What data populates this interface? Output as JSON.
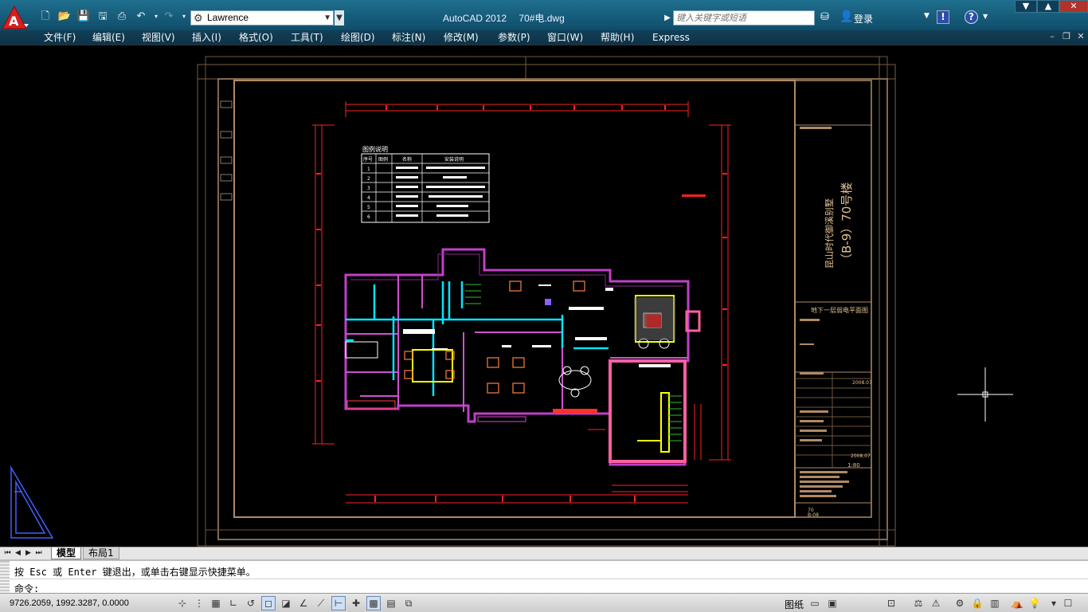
{
  "app": {
    "title": "AutoCAD 2012",
    "document": "70#电.dwg",
    "workspace": "Lawrence",
    "search_placeholder": "键入关键字或短语",
    "login_label": "登录",
    "logo_letter": "A"
  },
  "quick_access": [
    "new-icon",
    "open-icon",
    "save-icon",
    "save-as-icon",
    "print-icon",
    "undo-icon",
    "redo-icon"
  ],
  "menu": {
    "items": [
      "文件(F)",
      "编辑(E)",
      "视图(V)",
      "插入(I)",
      "格式(O)",
      "工具(T)",
      "绘图(D)",
      "标注(N)",
      "修改(M)",
      "参数(P)",
      "窗口(W)",
      "帮助(H)",
      "Express"
    ]
  },
  "drawing": {
    "title_block_project": "昆山时代御溪别墅",
    "title_block_building": "（B-9）70号楼",
    "title_block_sheet": "地下一层弱电平面图",
    "legend_title": "图例说明",
    "legend_headers": [
      "序号",
      "图例",
      "名称",
      "安装说明"
    ],
    "legend_numbers": [
      "1",
      "2",
      "3",
      "4",
      "5",
      "6"
    ],
    "title_block_date1": "2008.07",
    "title_block_date2": "2008.07",
    "title_block_scale": "1:80",
    "title_block_sheet_no": "70",
    "title_block_sheet_code": "B-08"
  },
  "layout_tabs": {
    "model": "模型",
    "layout1": "布局1"
  },
  "command": {
    "history": "按 Esc 或 Enter 键退出，或单击右键显示快捷菜单。",
    "prompt": "命令:"
  },
  "status": {
    "coordinates": "9726.2059, 1992.3287, 0.0000",
    "paper_label": "图纸"
  },
  "colors": {
    "titlebar": "#1a6585",
    "menubar": "#123f57",
    "canvas": "#000000",
    "frame": "#b08a66",
    "wall_magenta": "#d040d0",
    "pipe_cyan": "#00e5ff",
    "dim_red": "#ff2020",
    "accent_yellow": "#ffff00"
  }
}
